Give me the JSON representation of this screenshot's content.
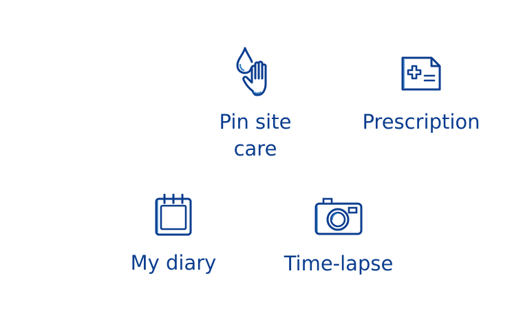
{
  "colors": {
    "accent": "#0b3d8f",
    "accent_light": "#3f86c8"
  },
  "tiles": [
    {
      "label": "Pin site care",
      "label_line1": "Pin site",
      "label_line2": "care",
      "icon": "droplet-hand-icon"
    },
    {
      "label": "Prescription",
      "icon": "prescription-icon"
    },
    {
      "label": "My diary",
      "icon": "calendar-icon"
    },
    {
      "label": "Time-lapse",
      "icon": "camera-icon"
    }
  ]
}
